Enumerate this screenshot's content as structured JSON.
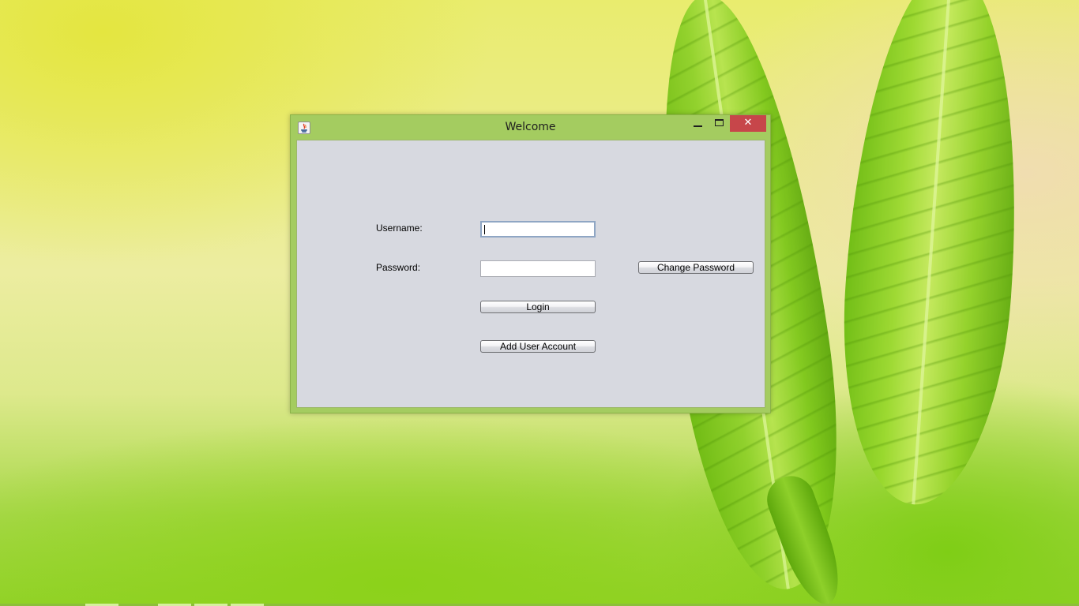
{
  "window": {
    "title": "Welcome",
    "close_glyph": "✕",
    "icon": "java-coffee-cup-icon"
  },
  "form": {
    "username_label": "Username:",
    "username_value": "",
    "password_label": "Password:",
    "password_value": "",
    "change_password_label": "Change Password",
    "login_label": "Login",
    "add_user_label": "Add User Account"
  },
  "colors": {
    "titlebar": "#a4cc60",
    "close_button": "#c7464a",
    "panel": "#d7d9e0"
  }
}
